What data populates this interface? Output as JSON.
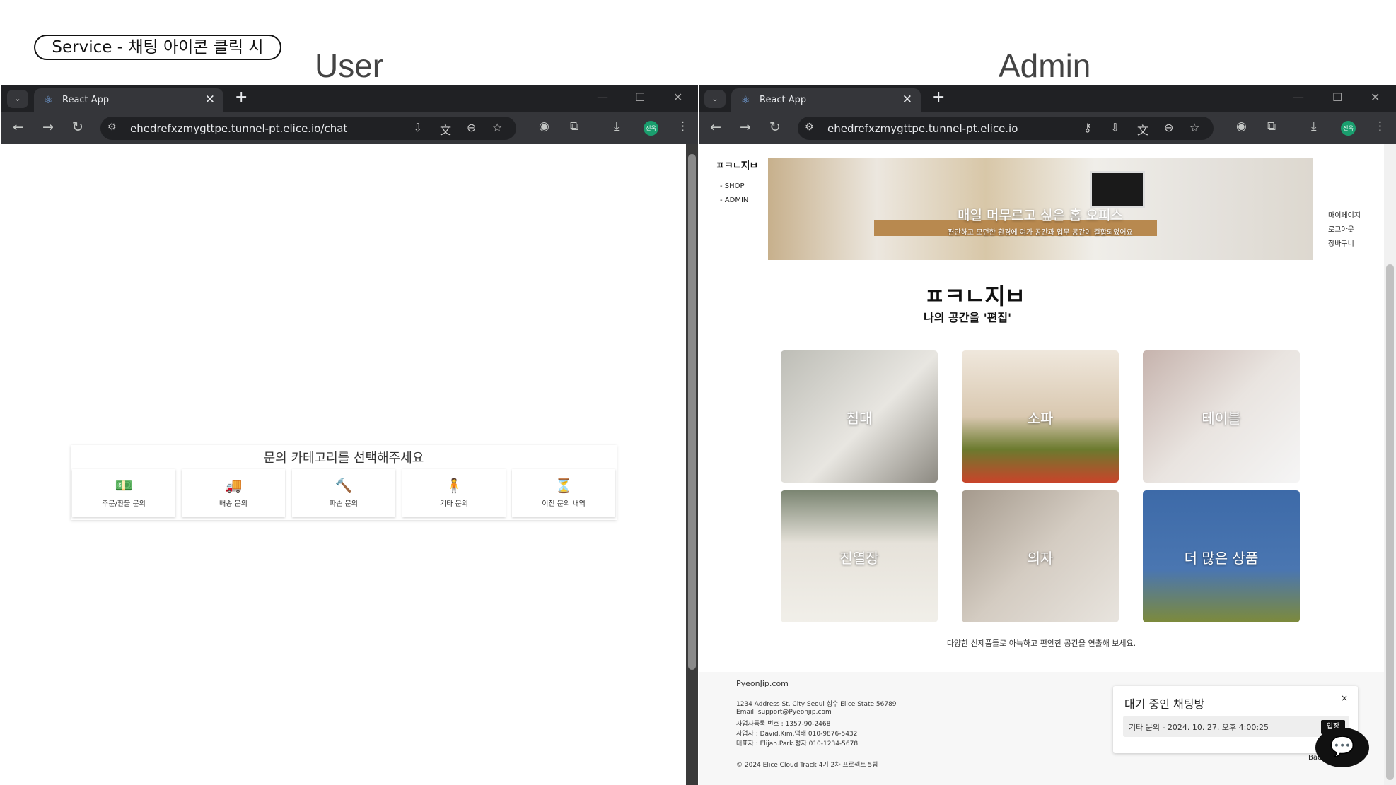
{
  "slide": {
    "service_label": "Service - 채팅 아이콘 클릭 시",
    "user_title": "User",
    "admin_title": "Admin"
  },
  "browser": {
    "tab_title": "React App",
    "close_glyph": "✕",
    "newtab_glyph": "+",
    "profile_label": "진욱",
    "win_min": "—",
    "win_max": "☐",
    "win_close": "✕",
    "back_glyph": "←",
    "forward_glyph": "→",
    "reload_glyph": "↻",
    "menu_glyph": "⋮",
    "tab_dd_glyph": "⌄"
  },
  "user_window": {
    "url": "ehedrefxzmygttpe.tunnel-pt.elice.io/chat",
    "chat": {
      "title": "문의 카테고리를 선택해주세요",
      "categories": [
        {
          "icon": "money-icon",
          "glyph": "💵",
          "label": "주문/환불 문의"
        },
        {
          "icon": "truck-icon",
          "glyph": "🚚",
          "label": "배송 문의"
        },
        {
          "icon": "hammer-icon",
          "glyph": "🔨",
          "label": "파손 문의"
        },
        {
          "icon": "person-icon",
          "glyph": "🧍",
          "label": "기타 문의"
        },
        {
          "icon": "hourglass-icon",
          "glyph": "⏳",
          "label": "이전 문의 내역"
        }
      ]
    }
  },
  "admin_window": {
    "url": "ehedrefxzmygttpe.tunnel-pt.elice.io",
    "logo": "ㅍㅋㄴ지ㅂ",
    "nav": [
      "SHOP",
      "ADMIN"
    ],
    "banner": {
      "title": "매일 머무르고 싶은 홈 오피스",
      "subtitle": "편안하고 모던한 환경에 여가 공간과 업무 공간이 결합되었어요"
    },
    "right_links": [
      "마이페이지",
      "로그아웃",
      "장바구니"
    ],
    "tagline": "나의 공간을 '편집'",
    "tiles": [
      "침대",
      "소파",
      "테이블",
      "진열장",
      "의자",
      "더 많은 상품"
    ],
    "description": "다양한 신제품들로 아늑하고 편안한 공간을 연출해 보세요.",
    "footer": {
      "site": "PyeonJip.com",
      "address": "1234 Address St. City Seoul 성수 Elice State 56789",
      "email": "Email: support@Pyeonjip.com",
      "business_no": "사업자등록 번호 : 1357-90-2468",
      "manager": "사업자 : David.Kim.덕배 010-9876-5432",
      "ceo": "대표자 : Elijah.Park.정자 010-1234-5678",
      "copyright": "© 2024 Elice Cloud Track 4기 2차 프로젝트 5팀",
      "back_to_top": "Back to"
    },
    "waiting": {
      "title": "대기 중인 채팅방",
      "close": "×",
      "item": "기타 문의 - 2024. 10. 27. 오후 4:00:25",
      "enter": "입장"
    },
    "chat_button_glyph": "💬"
  }
}
